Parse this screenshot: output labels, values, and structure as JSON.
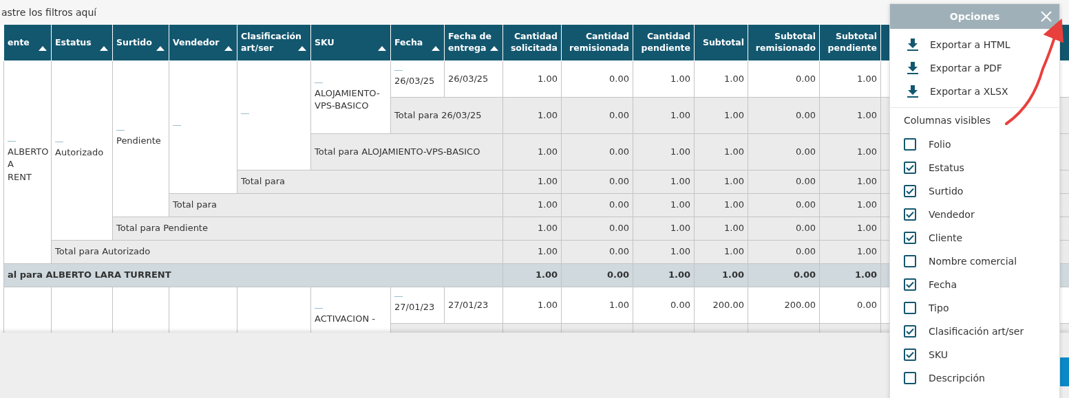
{
  "filter_bar": {
    "hint": "astre los filtros aquí"
  },
  "table": {
    "columns": [
      {
        "label": "ente",
        "kind": "text",
        "sortable": true
      },
      {
        "label": "Estatus",
        "kind": "text",
        "sortable": true
      },
      {
        "label": "Surtido",
        "kind": "text",
        "sortable": true
      },
      {
        "label": "Vendedor",
        "kind": "text",
        "sortable": true
      },
      {
        "label": "Clasificación art/ser",
        "kind": "text",
        "sortable": true
      },
      {
        "label": "SKU",
        "kind": "text",
        "sortable": true
      },
      {
        "label": "Fecha",
        "kind": "text",
        "sortable": true
      },
      {
        "label": "Fecha de entrega",
        "kind": "text",
        "sortable": true
      },
      {
        "label": "Cantidad solicitada",
        "kind": "number",
        "sortable": false
      },
      {
        "label": "Cantidad remisionada",
        "kind": "number",
        "sortable": false
      },
      {
        "label": "Cantidad pendiente",
        "kind": "number",
        "sortable": false
      },
      {
        "label": "Subtotal",
        "kind": "number",
        "sortable": false
      },
      {
        "label": "Subtotal remisionado",
        "kind": "number",
        "sortable": false
      },
      {
        "label": "Subtotal pendiente",
        "kind": "number",
        "sortable": false
      }
    ],
    "rows": [
      {
        "kind": "data",
        "cells": [
          {
            "text": "ALBERTO\nA\nRENT",
            "rowspan": 7,
            "link": true
          },
          {
            "text": "Autorizado",
            "rowspan": 6,
            "link": true
          },
          {
            "text": "Pendiente",
            "rowspan": 5,
            "link": true
          },
          {
            "rowspan": 4,
            "link": true
          },
          {
            "rowspan": 3,
            "link": true
          },
          {
            "text": "ALOJAMIENTO-VPS-BASICO",
            "rowspan": 2,
            "link": true
          },
          {
            "text": "26/03/25",
            "link": true
          },
          {
            "text": "26/03/25"
          },
          {
            "text": "1.00"
          },
          {
            "text": "0.00"
          },
          {
            "text": "1.00"
          },
          {
            "text": "1.00"
          },
          {
            "text": "0.00"
          },
          {
            "text": "1.00"
          }
        ]
      },
      {
        "kind": "total",
        "cells": [
          {
            "text": "Total para 26/03/25",
            "colspan": 2
          },
          {
            "text": "1.00"
          },
          {
            "text": "0.00"
          },
          {
            "text": "1.00"
          },
          {
            "text": "1.00"
          },
          {
            "text": "0.00"
          },
          {
            "text": "1.00"
          }
        ]
      },
      {
        "kind": "total",
        "cells": [
          {
            "text": "Total para ALOJAMIENTO-VPS-BASICO",
            "colspan": 3
          },
          {
            "text": "1.00"
          },
          {
            "text": "0.00"
          },
          {
            "text": "1.00"
          },
          {
            "text": "1.00"
          },
          {
            "text": "0.00"
          },
          {
            "text": "1.00"
          }
        ]
      },
      {
        "kind": "total",
        "cells": [
          {
            "text": "Total para",
            "colspan": 4
          },
          {
            "text": "1.00"
          },
          {
            "text": "0.00"
          },
          {
            "text": "1.00"
          },
          {
            "text": "1.00"
          },
          {
            "text": "0.00"
          },
          {
            "text": "1.00"
          }
        ]
      },
      {
        "kind": "total",
        "cells": [
          {
            "text": "Total para",
            "colspan": 5
          },
          {
            "text": "1.00"
          },
          {
            "text": "0.00"
          },
          {
            "text": "1.00"
          },
          {
            "text": "1.00"
          },
          {
            "text": "0.00"
          },
          {
            "text": "1.00"
          }
        ]
      },
      {
        "kind": "total",
        "cells": [
          {
            "text": "Total para Pendiente",
            "colspan": 6
          },
          {
            "text": "1.00"
          },
          {
            "text": "0.00"
          },
          {
            "text": "1.00"
          },
          {
            "text": "1.00"
          },
          {
            "text": "0.00"
          },
          {
            "text": "1.00"
          }
        ]
      },
      {
        "kind": "total",
        "cells": [
          {
            "text": "Total para Autorizado",
            "colspan": 7
          },
          {
            "text": "1.00"
          },
          {
            "text": "0.00"
          },
          {
            "text": "1.00"
          },
          {
            "text": "1.00"
          },
          {
            "text": "0.00"
          },
          {
            "text": "1.00"
          }
        ]
      },
      {
        "kind": "grand",
        "cells": [
          {
            "text": "al para ALBERTO LARA TURRENT",
            "colspan": 8
          },
          {
            "text": "1.00"
          },
          {
            "text": "0.00"
          },
          {
            "text": "1.00"
          },
          {
            "text": "1.00"
          },
          {
            "text": "0.00"
          },
          {
            "text": "1.00"
          }
        ]
      },
      {
        "kind": "data",
        "cells": [
          {
            "rowspan": 2
          },
          {
            "rowspan": 2
          },
          {
            "rowspan": 2
          },
          {
            "rowspan": 2
          },
          {
            "rowspan": 2
          },
          {
            "text": "ACTIVACION -",
            "rowspan": 2,
            "link": true
          },
          {
            "text": "27/01/23",
            "link": true
          },
          {
            "text": "27/01/23"
          },
          {
            "text": "1.00"
          },
          {
            "text": "1.00"
          },
          {
            "text": "0.00"
          },
          {
            "text": "200.00"
          },
          {
            "text": "200.00"
          },
          {
            "text": "0.00"
          }
        ]
      },
      {
        "kind": "total",
        "cells": [
          {
            "colspan": 2
          },
          {},
          {},
          {},
          {},
          {},
          {}
        ]
      }
    ]
  },
  "options": {
    "title": "Opciones",
    "exports": [
      "Exportar a HTML",
      "Exportar a PDF",
      "Exportar a XLSX"
    ],
    "columns_heading": "Columnas visibles",
    "columns": [
      {
        "label": "Folio",
        "checked": false
      },
      {
        "label": "Estatus",
        "checked": true
      },
      {
        "label": "Surtido",
        "checked": true
      },
      {
        "label": "Vendedor",
        "checked": true
      },
      {
        "label": "Cliente",
        "checked": true
      },
      {
        "label": "Nombre comercial",
        "checked": false
      },
      {
        "label": "Fecha",
        "checked": true
      },
      {
        "label": "Tipo",
        "checked": false
      },
      {
        "label": "Clasificación art/ser",
        "checked": true
      },
      {
        "label": "SKU",
        "checked": true
      },
      {
        "label": "Descripción",
        "checked": false
      }
    ]
  }
}
